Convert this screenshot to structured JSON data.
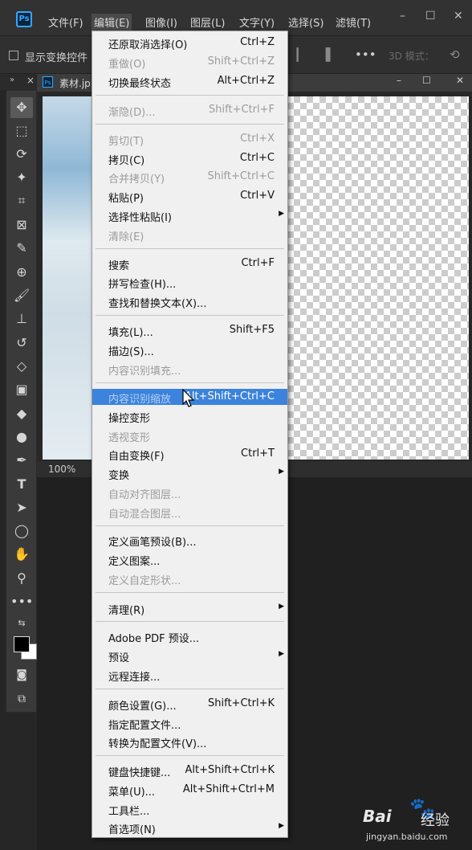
{
  "app": {
    "logo": "Ps"
  },
  "menubar": {
    "items": [
      "文件(F)",
      "编辑(E)",
      "图像(I)",
      "图层(L)",
      "文字(Y)",
      "选择(S)",
      "滤镜(T)"
    ],
    "active": "编辑(E)",
    "window_controls": [
      "–",
      "☐",
      "✕"
    ]
  },
  "options": {
    "show_transform_label": "显示变换控件",
    "more": "•••",
    "mode_3d": "3D 模式："
  },
  "document": {
    "name": "素材.jp",
    "zoom": "100%"
  },
  "tools": {
    "icons": [
      "move-icon",
      "marquee-icon",
      "lasso-icon",
      "magic-wand-icon",
      "crop-icon",
      "frame-icon",
      "eyedropper-icon",
      "healing-icon",
      "brush-icon",
      "stamp-icon",
      "history-brush-icon",
      "eraser-icon",
      "gradient-icon",
      "blur-icon",
      "dodge-icon",
      "pen-icon",
      "type-icon",
      "path-select-icon",
      "ellipse-icon",
      "hand-icon",
      "zoom-icon",
      "more-tools-icon"
    ],
    "foreground_color": "#000000",
    "background_color": "#ffffff"
  },
  "edit_menu": {
    "highlight_color": "#3b83dc",
    "undo": {
      "label": "还原取消选择(O)",
      "shortcut": "Ctrl+Z"
    },
    "redo": {
      "label": "重做(O)",
      "shortcut": "Shift+Ctrl+Z"
    },
    "toggle_last_state": {
      "label": "切换最终状态",
      "shortcut": "Alt+Ctrl+Z"
    },
    "fade": {
      "label": "渐隐(D)...",
      "shortcut": "Shift+Ctrl+F"
    },
    "cut": {
      "label": "剪切(T)",
      "shortcut": "Ctrl+X"
    },
    "copy": {
      "label": "拷贝(C)",
      "shortcut": "Ctrl+C"
    },
    "copy_merged": {
      "label": "合并拷贝(Y)",
      "shortcut": "Shift+Ctrl+C"
    },
    "paste": {
      "label": "粘贴(P)",
      "shortcut": "Ctrl+V"
    },
    "paste_special": {
      "label": "选择性粘贴(I)"
    },
    "clear": {
      "label": "清除(E)"
    },
    "search": {
      "label": "搜索",
      "shortcut": "Ctrl+F"
    },
    "check_spelling": {
      "label": "拼写检查(H)..."
    },
    "find_replace": {
      "label": "查找和替换文本(X)..."
    },
    "fill": {
      "label": "填充(L)...",
      "shortcut": "Shift+F5"
    },
    "stroke": {
      "label": "描边(S)..."
    },
    "content_aware_fill": {
      "label": "内容识别填充..."
    },
    "content_aware_scale": {
      "label": "内容识别缩放",
      "shortcut": "Alt+Shift+Ctrl+C"
    },
    "puppet_warp": {
      "label": "操控变形"
    },
    "perspective_warp": {
      "label": "透视变形"
    },
    "free_transform": {
      "label": "自由变换(F)",
      "shortcut": "Ctrl+T"
    },
    "transform": {
      "label": "变换"
    },
    "auto_align": {
      "label": "自动对齐图层..."
    },
    "auto_blend": {
      "label": "自动混合图层..."
    },
    "define_brush": {
      "label": "定义画笔预设(B)..."
    },
    "define_pattern": {
      "label": "定义图案..."
    },
    "define_shape": {
      "label": "定义自定形状..."
    },
    "purge": {
      "label": "清理(R)"
    },
    "pdf_presets": {
      "label": "Adobe PDF 预设..."
    },
    "presets": {
      "label": "预设"
    },
    "remote_connections": {
      "label": "远程连接..."
    },
    "color_settings": {
      "label": "颜色设置(G)...",
      "shortcut": "Shift+Ctrl+K"
    },
    "assign_profile": {
      "label": "指定配置文件..."
    },
    "convert_profile": {
      "label": "转换为配置文件(V)..."
    },
    "keyboard_shortcuts": {
      "label": "键盘快捷键...",
      "shortcut": "Alt+Shift+Ctrl+K"
    },
    "menus": {
      "label": "菜单(U)...",
      "shortcut": "Alt+Shift+Ctrl+M"
    },
    "toolbar": {
      "label": "工具栏..."
    },
    "preferences": {
      "label": "首选项(N)"
    }
  },
  "watermark": {
    "brand": "Bai",
    "cn": "经验",
    "url": "jingyan.baidu.com"
  }
}
